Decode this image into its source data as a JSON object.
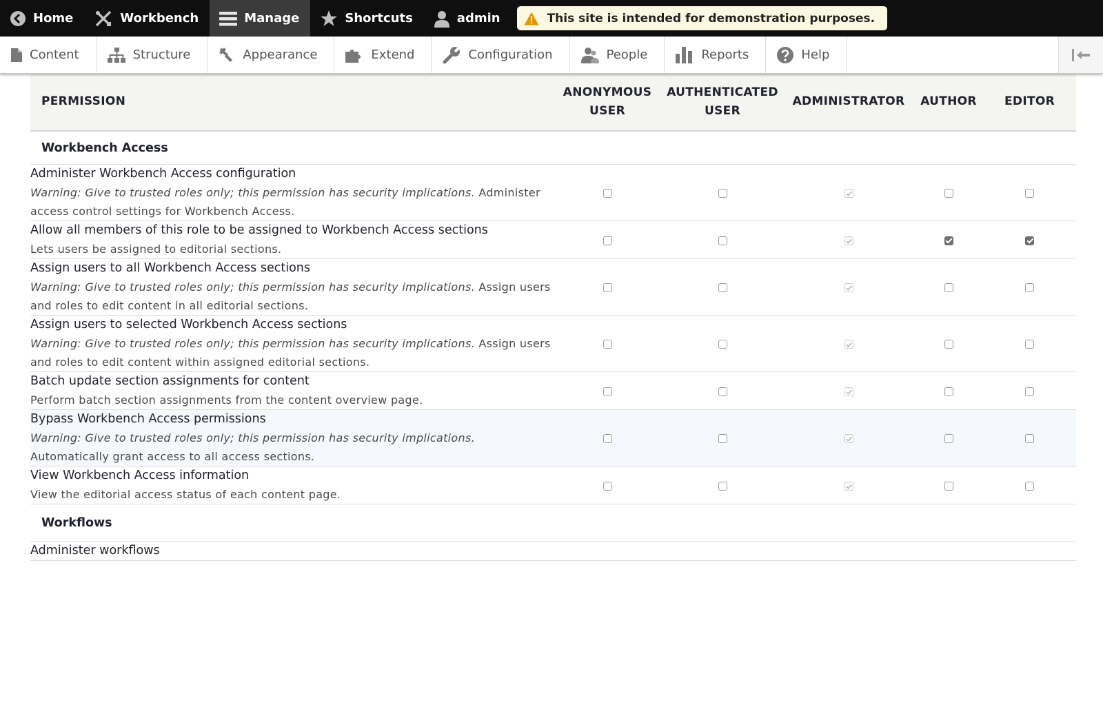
{
  "toolbar": {
    "home": "Home",
    "workbench": "Workbench",
    "manage": "Manage",
    "shortcuts": "Shortcuts",
    "user": "admin",
    "demo_notice": "This site is intended for demonstration purposes.",
    "colors": {
      "bar_bg": "#0f0f0f",
      "active_bg": "#3b3b3b",
      "notice_bg": "#fdf8e1",
      "warning_icon": "#e29700"
    }
  },
  "tray": {
    "items": [
      "Content",
      "Structure",
      "Appearance",
      "Extend",
      "Configuration",
      "People",
      "Reports",
      "Help"
    ],
    "icons": [
      "file-icon",
      "structure-icon",
      "paintbrush-icon",
      "puzzle-icon",
      "wrench-icon",
      "people-icon",
      "bar-chart-icon",
      "help-icon"
    ]
  },
  "table": {
    "headers": {
      "permission": "PERMISSION",
      "anonymous_line1": "ANONYMOUS",
      "anonymous_line2": "USER",
      "authenticated_line1": "AUTHENTICATED",
      "authenticated_line2": "USER",
      "administrator": "ADMINISTRATOR",
      "author": "AUTHOR",
      "editor": "EDITOR"
    },
    "sections": [
      {
        "title": "Workbench Access",
        "rows": [
          {
            "title": "Administer Workbench Access configuration",
            "warning": "Warning: Give to trusted roles only; this permission has security implications.",
            "description": " Administer access control settings for Workbench Access.",
            "checks": [
              false,
              false,
              "inherited",
              false,
              false
            ]
          },
          {
            "title": "Allow all members of this role to be assigned to Workbench Access sections",
            "warning": "",
            "description": "Lets users be assigned to editorial sections.",
            "checks": [
              false,
              false,
              "inherited",
              true,
              true
            ]
          },
          {
            "title": "Assign users to all Workbench Access sections",
            "warning": "Warning: Give to trusted roles only; this permission has security implications.",
            "description": " Assign users and roles to edit content in all editorial sections.",
            "checks": [
              false,
              false,
              "inherited",
              false,
              false
            ]
          },
          {
            "title": "Assign users to selected Workbench Access sections",
            "warning": "Warning: Give to trusted roles only; this permission has security implications.",
            "description": " Assign users and roles to edit content within assigned editorial sections.",
            "checks": [
              false,
              false,
              "inherited",
              false,
              false
            ]
          },
          {
            "title": "Batch update section assignments for content",
            "warning": "",
            "description": "Perform batch section assignments from the content overview page.",
            "checks": [
              false,
              false,
              "inherited",
              false,
              false
            ]
          },
          {
            "title": "Bypass Workbench Access permissions",
            "warning": "Warning: Give to trusted roles only; this permission has security implications.",
            "description": " Automatically grant access to all access sections.",
            "checks": [
              false,
              false,
              "inherited",
              false,
              false
            ]
          },
          {
            "title": "View Workbench Access information",
            "warning": "",
            "description": "View the editorial access status of each content page.",
            "checks": [
              false,
              false,
              "inherited",
              false,
              false
            ]
          }
        ]
      },
      {
        "title": "Workflows",
        "rows": [
          {
            "title": "Administer workflows",
            "warning": "",
            "description": "",
            "checks": [
              false,
              false,
              "inherited",
              false,
              false
            ]
          }
        ]
      }
    ]
  }
}
